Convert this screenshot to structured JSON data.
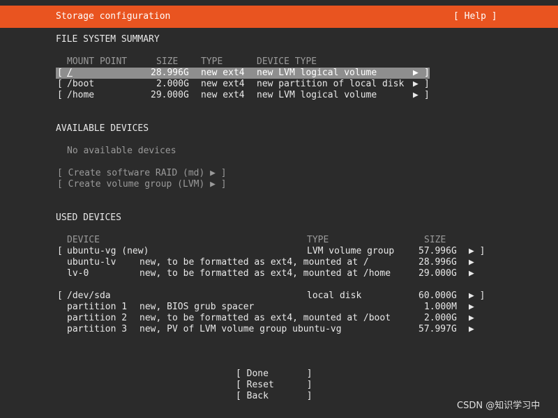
{
  "header": {
    "title": "Storage configuration",
    "help": "[ Help ]"
  },
  "fs_summary": {
    "heading": "FILE SYSTEM SUMMARY",
    "columns": [
      "MOUNT POINT",
      "SIZE",
      "TYPE",
      "DEVICE TYPE"
    ],
    "rows": [
      {
        "open": "[",
        "mount": "/",
        "size": "28.996G",
        "type": "new ext4",
        "device_type": "new LVM logical volume",
        "arrow": "▶",
        "close": "]"
      },
      {
        "open": "[",
        "mount": "/boot",
        "size": "2.000G",
        "type": "new ext4",
        "device_type": "new partition of local disk",
        "arrow": "▶",
        "close": "]"
      },
      {
        "open": "[",
        "mount": "/home",
        "size": "29.000G",
        "type": "new ext4",
        "device_type": "new LVM logical volume",
        "arrow": "▶",
        "close": "]"
      }
    ]
  },
  "available": {
    "heading": "AVAILABLE DEVICES",
    "empty_text": "No available devices",
    "actions": [
      {
        "label": "[ Create software RAID (md) ▶ ]"
      },
      {
        "label": "[ Create volume group (LVM) ▶ ]"
      }
    ]
  },
  "used": {
    "heading": "USED DEVICES",
    "columns": [
      "DEVICE",
      "TYPE",
      "SIZE"
    ],
    "devices": [
      {
        "open": "[",
        "name": "ubuntu-vg (new)",
        "type": "LVM volume group",
        "size": "57.996G",
        "arrow": "▶ ]",
        "children": [
          {
            "name": "ubuntu-lv",
            "desc": "new, to be formatted as ext4, mounted at /",
            "size": "28.996G",
            "arrow": "▶"
          },
          {
            "name": "lv-0",
            "desc": "new, to be formatted as ext4, mounted at /home",
            "size": "29.000G",
            "arrow": "▶"
          }
        ]
      },
      {
        "open": "[",
        "name": "/dev/sda",
        "type": "local disk",
        "size": "60.000G",
        "arrow": "▶ ]",
        "children": [
          {
            "name": "partition 1",
            "desc": "new, BIOS grub spacer",
            "size": "1.000M",
            "arrow": "▶"
          },
          {
            "name": "partition 2",
            "desc": "new, to be formatted as ext4, mounted at /boot",
            "size": "2.000G",
            "arrow": "▶"
          },
          {
            "name": "partition 3",
            "desc": "new, PV of LVM volume group ubuntu-vg",
            "size": "57.997G",
            "arrow": "▶"
          }
        ]
      }
    ]
  },
  "buttons": {
    "done": "[ Done       ]",
    "reset": "[ Reset      ]",
    "back": "[ Back       ]"
  },
  "watermark": "CSDN @知识学习中",
  "colors": {
    "background": "#2b2b2b",
    "header": "#e95420",
    "selection": "#8e8e8e"
  }
}
